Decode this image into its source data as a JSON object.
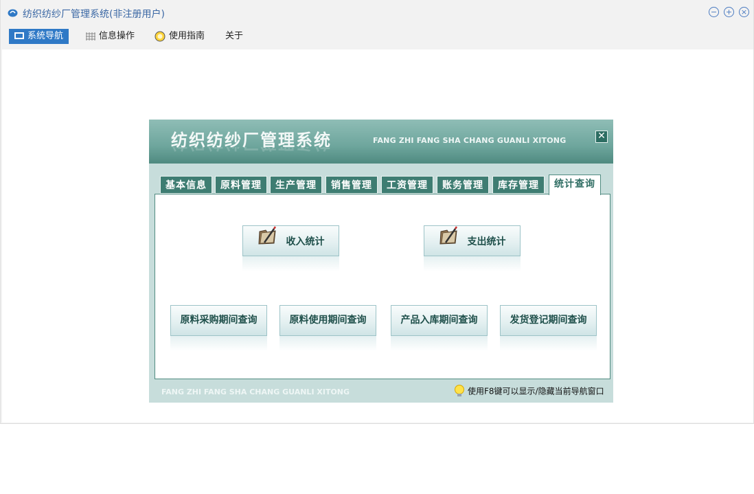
{
  "window": {
    "title": "纺织纺纱厂管理系统(非注册用户)",
    "controls": [
      "minimize-icon",
      "maximize-icon",
      "close-icon"
    ]
  },
  "menubar": {
    "items": [
      {
        "label": "系统导航",
        "icon": "monitor-icon",
        "active": true
      },
      {
        "label": "信息操作",
        "icon": "grid-icon",
        "active": false
      },
      {
        "label": "使用指南",
        "icon": "help-bulb-icon",
        "active": false
      },
      {
        "label": "关于",
        "icon": "",
        "active": false
      }
    ]
  },
  "panel": {
    "title": "纺织纺纱厂管理系统",
    "subtitle": "FANG ZHI FANG SHA CHANG GUANLI XITONG",
    "tabs": [
      "基本信息",
      "原料管理",
      "生产管理",
      "销售管理",
      "工资管理",
      "账务管理",
      "库存管理",
      "统计查询"
    ],
    "active_tab": "统计查询",
    "buttons_top": [
      "收入统计",
      "支出统计"
    ],
    "buttons_bottom": [
      "原料采购期间查询",
      "原料使用期间查询",
      "产品入库期间查询",
      "发货登记期间查询"
    ],
    "footer_text": "FANG ZHI FANG SHA CHANG GUANLI XITONG",
    "hint": "使用F8键可以显示/隐藏当前导航窗口"
  },
  "colors": {
    "accent": "#2f79c6",
    "title_text": "#3a67a4",
    "panel_header": "#6ea69d",
    "tab_bg": "#3e7d72",
    "panel_bg": "#c7dddb"
  }
}
